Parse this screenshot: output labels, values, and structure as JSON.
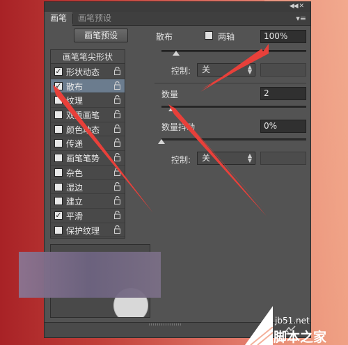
{
  "tabs": [
    {
      "label": "画笔",
      "active": true
    },
    {
      "label": "画笔预设",
      "active": false
    }
  ],
  "preset_button": "画笔预设",
  "list": {
    "header": "画笔笔尖形状",
    "items": [
      {
        "label": "形状动态",
        "checked": true,
        "selected": false
      },
      {
        "label": "散布",
        "checked": true,
        "selected": true
      },
      {
        "label": "纹理",
        "checked": false,
        "selected": false
      },
      {
        "label": "双重画笔",
        "checked": false,
        "selected": false
      },
      {
        "label": "颜色动态",
        "checked": false,
        "selected": false
      },
      {
        "label": "传递",
        "checked": false,
        "selected": false
      },
      {
        "label": "画笔笔势",
        "checked": false,
        "selected": false
      },
      {
        "label": "杂色",
        "checked": false,
        "selected": false
      },
      {
        "label": "湿边",
        "checked": false,
        "selected": false
      },
      {
        "label": "建立",
        "checked": false,
        "selected": false
      },
      {
        "label": "平滑",
        "checked": true,
        "selected": false
      },
      {
        "label": "保护纹理",
        "checked": false,
        "selected": false
      }
    ]
  },
  "scatter": {
    "label": "散布",
    "both_axes_label": "两轴",
    "both_axes_checked": false,
    "value": "100%",
    "slider_fraction": 0.1
  },
  "control1": {
    "label": "控制:",
    "value": "关"
  },
  "count": {
    "label": "数量",
    "value": "2",
    "slider_fraction": 0.07
  },
  "count_jitter": {
    "label": "数量抖动",
    "value": "0%",
    "slider_fraction": 0.0
  },
  "control2": {
    "label": "控制:",
    "value": "关"
  },
  "watermark": {
    "sub": "jb51.net",
    "main": "脚本之家"
  },
  "colors": {
    "panel": "#535353",
    "selected_row": "#6b7c8e",
    "arrow": "#e8403a"
  }
}
